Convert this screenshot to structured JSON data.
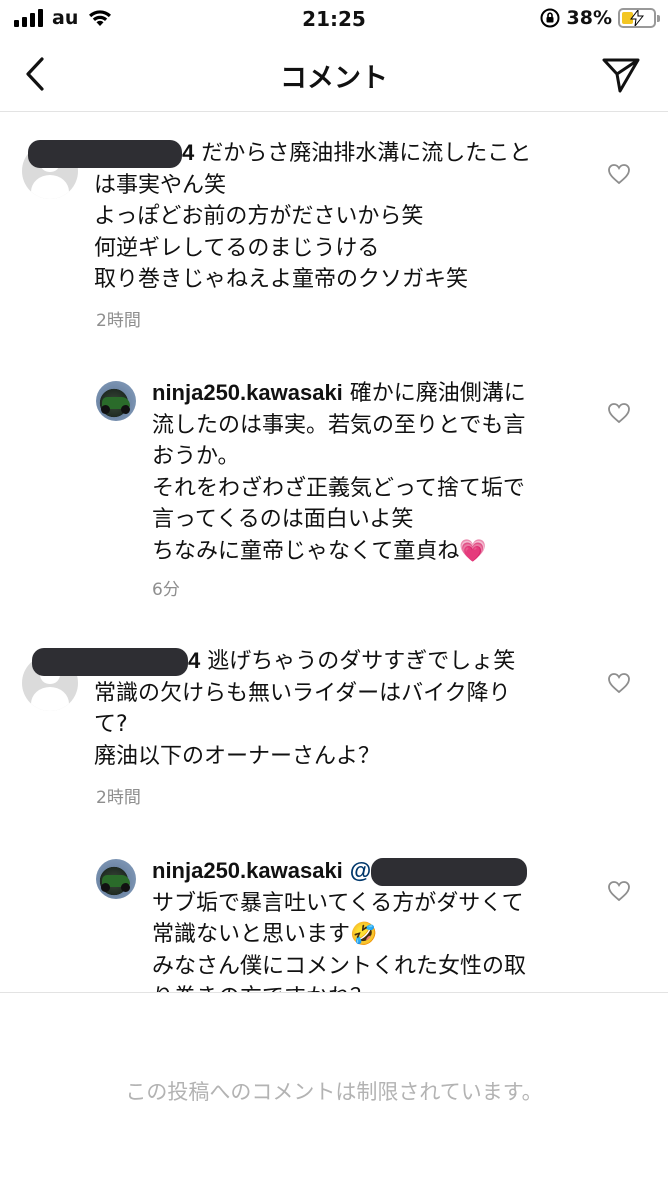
{
  "status_bar": {
    "carrier": "au",
    "time": "21:25",
    "battery_percent": "38%",
    "battery_level": 0.38,
    "icons": [
      "signal-bars-icon",
      "wifi-icon",
      "orientation-lock-icon",
      "battery-charging-icon"
    ]
  },
  "header": {
    "title": "コメント",
    "back_icon": "chevron-left-icon",
    "send_icon": "paper-plane-icon"
  },
  "comments": [
    {
      "username_visible_suffix": "4",
      "lines": [
        "だからさ廃油排水溝に流したこと",
        "は事実やん笑",
        "よっぽどお前の方がださいから笑",
        "何逆ギレしてるのまじうける",
        "取り巻きじゃねえよ童帝のクソガキ笑"
      ],
      "time": "2時間"
    },
    {
      "username": "ninja250.kawasaki",
      "lines": [
        "確かに廃油側溝に",
        "流したのは事実。若気の至りとでも言",
        "おうか。",
        "それをわざわざ正義気どって捨て垢で",
        "言ってくるのは面白いよ笑",
        "ちなみに童帝じゃなくて童貞ね💗"
      ],
      "time": "6分"
    },
    {
      "username_visible_suffix": "4",
      "lines": [
        "逃げちゃうのダサすぎでしょ笑",
        "常識の欠けらも無いライダーはバイク降り",
        "て?",
        "廃油以下のオーナーさんよ？"
      ],
      "time": "2時間"
    },
    {
      "username": "ninja250.kawasaki",
      "mention_prefix": "@",
      "lines": [
        "サブ垢で暴言吐いてくる方がダサくて",
        "常識ないと思います🤣",
        "みなさん僕にコメントくれた女性の取",
        "り巻きの方ですかね？"
      ]
    }
  ],
  "footer": {
    "restricted_text": "この投稿へのコメントは制限されています。"
  },
  "colors": {
    "text": "#111111",
    "meta": "#8e8e8e",
    "redaction": "#2e2e33",
    "restricted": "#b3b3b3",
    "battery_fill": "#f3c623"
  }
}
